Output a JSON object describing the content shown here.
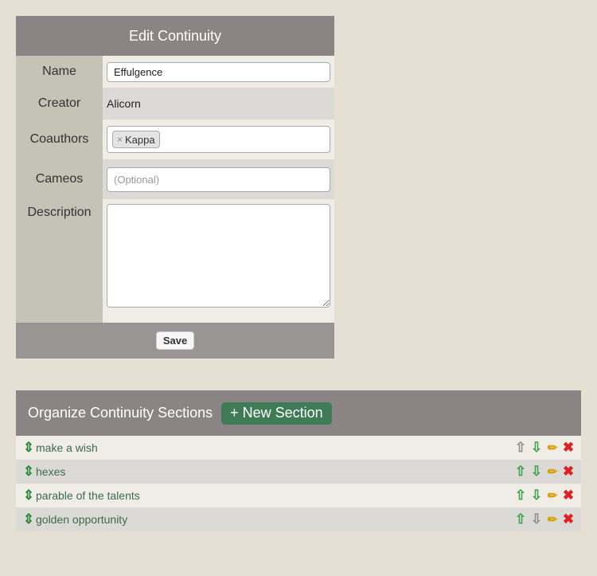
{
  "form": {
    "title": "Edit Continuity",
    "name_label": "Name",
    "name_value": "Effulgence",
    "creator_label": "Creator",
    "creator_value": "Alicorn",
    "coauthors_label": "Coauthors",
    "coauthors": [
      {
        "remove": "×",
        "name": "Kappa"
      }
    ],
    "cameos_label": "Cameos",
    "cameos_placeholder": "(Optional)",
    "description_label": "Description",
    "description_value": "",
    "save_label": "Save"
  },
  "sections": {
    "title": "Organize Continuity Sections",
    "new_button": "+ New Section",
    "items": [
      {
        "label": "make a wish",
        "up_enabled": false,
        "down_enabled": true
      },
      {
        "label": "hexes",
        "up_enabled": true,
        "down_enabled": true
      },
      {
        "label": "parable of the talents",
        "up_enabled": true,
        "down_enabled": true
      },
      {
        "label": "golden opportunity",
        "up_enabled": true,
        "down_enabled": false
      }
    ],
    "icons": {
      "drag": "⇕",
      "up": "⇧",
      "down": "⇩",
      "edit": "✏",
      "delete": "✖"
    }
  },
  "colors": {
    "header_bg": "#8a8584",
    "accent_green": "#3e7b56",
    "page_bg": "#e6e0d4"
  }
}
